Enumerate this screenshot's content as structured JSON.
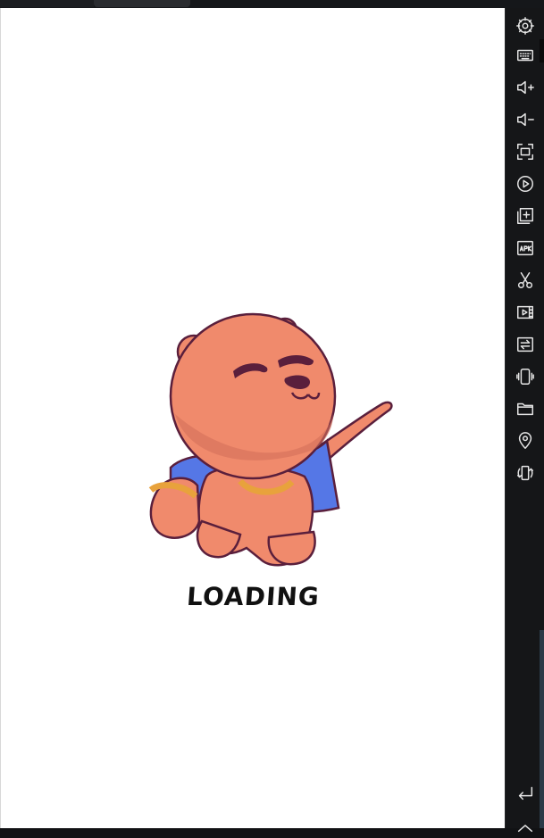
{
  "screen": {
    "loading_label": "LOADING",
    "splash_art": "cartoon-bear-pointing"
  },
  "sidebar": {
    "buttons": [
      {
        "name": "settings-button",
        "icon": "gear-icon"
      },
      {
        "name": "keyboard-button",
        "icon": "keyboard-icon"
      },
      {
        "name": "volume-up-button",
        "icon": "volume-up-icon"
      },
      {
        "name": "volume-down-button",
        "icon": "volume-down-icon"
      },
      {
        "name": "fullscreen-button",
        "icon": "fullscreen-icon"
      },
      {
        "name": "record-button",
        "icon": "record-icon"
      },
      {
        "name": "multi-instance-button",
        "icon": "multi-instance-icon"
      },
      {
        "name": "install-apk-button",
        "icon": "apk-icon"
      },
      {
        "name": "screenshot-button",
        "icon": "scissors-icon"
      },
      {
        "name": "video-button",
        "icon": "video-icon"
      },
      {
        "name": "sync-button",
        "icon": "sync-icon"
      },
      {
        "name": "shake-button",
        "icon": "shake-icon"
      },
      {
        "name": "shared-folder-button",
        "icon": "folder-icon"
      },
      {
        "name": "location-button",
        "icon": "location-icon"
      },
      {
        "name": "rotate-button",
        "icon": "rotate-icon"
      },
      {
        "name": "back-button",
        "icon": "back-icon"
      },
      {
        "name": "home-button",
        "icon": "home-icon"
      }
    ]
  },
  "colors": {
    "bear_fur": "#f08a6c",
    "bear_shadow": "#d4705a",
    "outline": "#5a1f3c",
    "jacket": "#5577e6",
    "sidebar_bg": "#151618"
  }
}
